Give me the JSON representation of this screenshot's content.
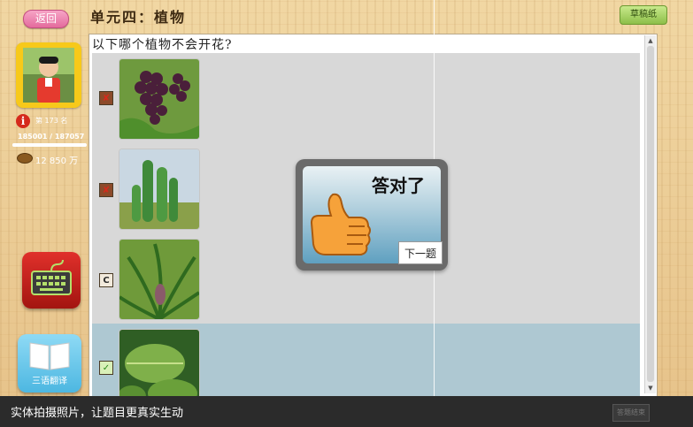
{
  "topbar": {
    "back_label": "返回",
    "unit_title": "单元四：植物",
    "draft_label": "草稿纸"
  },
  "user": {
    "rank": "第 173 名",
    "score": "185001 / 187057",
    "progress": 0.99,
    "coins": "12 850 万"
  },
  "sidebar": {
    "dictionary_label": "三语翻译"
  },
  "question": {
    "text": "以下哪个植物不会开花?",
    "options": [
      {
        "mark": "✘",
        "state": "wrong",
        "image": "grapes-photo"
      },
      {
        "mark": "✘",
        "state": "wrong",
        "image": "cactus-photo"
      },
      {
        "mark": "C",
        "state": "neutral",
        "image": "fern-photo"
      },
      {
        "mark": "✓",
        "state": "correct",
        "image": "leaf-photo"
      }
    ]
  },
  "dialog": {
    "title": "答对了",
    "next_label": "下一题"
  },
  "caption": {
    "text": "实体拍摄照片，让题目更真实生动",
    "right_button": "答题结束"
  },
  "colors": {
    "accent": "#f7c91a",
    "selected_row": "#aec8d2",
    "caption_bg": "#2b2b2b"
  }
}
